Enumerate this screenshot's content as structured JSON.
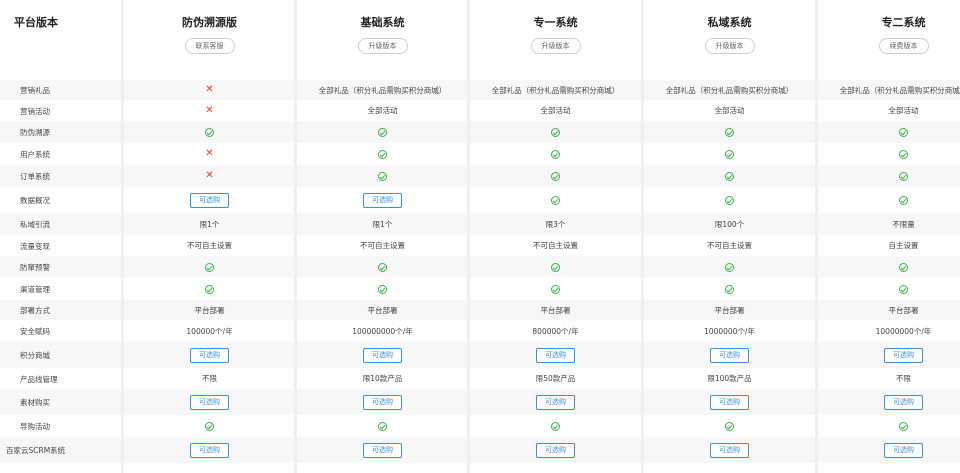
{
  "header_label": "平台版本",
  "plans": [
    {
      "name": "防伪溯源版",
      "button": "联系客服"
    },
    {
      "name": "基础系统",
      "button": "升级版本"
    },
    {
      "name": "专一系统",
      "button": "升级版本"
    },
    {
      "name": "私域系统",
      "button": "升级版本"
    },
    {
      "name": "专二系统",
      "button": "续费版本"
    }
  ],
  "cell_types": {
    "x": "cross-icon",
    "ok": "check-circle-icon",
    "opt": "optional-purchase-button"
  },
  "option_label": "可选购",
  "rows": [
    {
      "label": "营销礼品",
      "cells": [
        {
          "t": "x"
        },
        {
          "t": "text",
          "v": "全部礼品（积分礼品需购买积分商城）"
        },
        {
          "t": "text",
          "v": "全部礼品（积分礼品需购买积分商城）"
        },
        {
          "t": "text",
          "v": "全部礼品（积分礼品需购买积分商城）"
        },
        {
          "t": "text",
          "v": "全部礼品（积分礼品需购买积分商城）"
        }
      ]
    },
    {
      "label": "营销活动",
      "cells": [
        {
          "t": "x"
        },
        {
          "t": "text",
          "v": "全部活动"
        },
        {
          "t": "text",
          "v": "全部活动"
        },
        {
          "t": "text",
          "v": "全部活动"
        },
        {
          "t": "text",
          "v": "全部活动"
        }
      ]
    },
    {
      "label": "防伪溯源",
      "cells": [
        {
          "t": "ok"
        },
        {
          "t": "ok"
        },
        {
          "t": "ok"
        },
        {
          "t": "ok"
        },
        {
          "t": "ok"
        }
      ]
    },
    {
      "label": "用户系统",
      "cells": [
        {
          "t": "x"
        },
        {
          "t": "ok"
        },
        {
          "t": "ok"
        },
        {
          "t": "ok"
        },
        {
          "t": "ok"
        }
      ]
    },
    {
      "label": "订单系统",
      "cells": [
        {
          "t": "x"
        },
        {
          "t": "ok"
        },
        {
          "t": "ok"
        },
        {
          "t": "ok"
        },
        {
          "t": "ok"
        }
      ]
    },
    {
      "label": "数据概况",
      "cells": [
        {
          "t": "opt"
        },
        {
          "t": "opt"
        },
        {
          "t": "ok"
        },
        {
          "t": "ok"
        },
        {
          "t": "ok"
        }
      ]
    },
    {
      "label": "私域引流",
      "cells": [
        {
          "t": "text",
          "v": "限1个"
        },
        {
          "t": "text",
          "v": "限1个"
        },
        {
          "t": "text",
          "v": "限3个"
        },
        {
          "t": "text",
          "v": "限100个"
        },
        {
          "t": "text",
          "v": "不限量"
        }
      ]
    },
    {
      "label": "流量变现",
      "cells": [
        {
          "t": "text",
          "v": "不可自主设置"
        },
        {
          "t": "text",
          "v": "不可自主设置"
        },
        {
          "t": "text",
          "v": "不可自主设置"
        },
        {
          "t": "text",
          "v": "不可自主设置"
        },
        {
          "t": "text",
          "v": "自主设置"
        }
      ]
    },
    {
      "label": "防窜预警",
      "cells": [
        {
          "t": "ok"
        },
        {
          "t": "ok"
        },
        {
          "t": "ok"
        },
        {
          "t": "ok"
        },
        {
          "t": "ok"
        }
      ]
    },
    {
      "label": "渠道管理",
      "cells": [
        {
          "t": "ok"
        },
        {
          "t": "ok"
        },
        {
          "t": "ok"
        },
        {
          "t": "ok"
        },
        {
          "t": "ok"
        }
      ]
    },
    {
      "label": "部署方式",
      "cells": [
        {
          "t": "text",
          "v": "平台部署"
        },
        {
          "t": "text",
          "v": "平台部署"
        },
        {
          "t": "text",
          "v": "平台部署"
        },
        {
          "t": "text",
          "v": "平台部署"
        },
        {
          "t": "text",
          "v": "平台部署"
        }
      ]
    },
    {
      "label": "安全赋码",
      "cells": [
        {
          "t": "text",
          "v": "100000个/年"
        },
        {
          "t": "text",
          "v": "100000000个/年"
        },
        {
          "t": "text",
          "v": "800000个/年"
        },
        {
          "t": "text",
          "v": "1000000个/年"
        },
        {
          "t": "text",
          "v": "10000000个/年"
        }
      ]
    },
    {
      "label": "积分商城",
      "cells": [
        {
          "t": "opt"
        },
        {
          "t": "opt"
        },
        {
          "t": "opt"
        },
        {
          "t": "opt"
        },
        {
          "t": "opt"
        }
      ]
    },
    {
      "label": "产品线管理",
      "cells": [
        {
          "t": "text",
          "v": "不限"
        },
        {
          "t": "text",
          "v": "限10款产品"
        },
        {
          "t": "text",
          "v": "限50款产品"
        },
        {
          "t": "text",
          "v": "限100款产品"
        },
        {
          "t": "text",
          "v": "不限"
        }
      ]
    },
    {
      "label": "素材购买",
      "cells": [
        {
          "t": "opt"
        },
        {
          "t": "opt"
        },
        {
          "t": "opt"
        },
        {
          "t": "opt"
        },
        {
          "t": "opt"
        }
      ]
    },
    {
      "label": "导购活动",
      "cells": [
        {
          "t": "ok"
        },
        {
          "t": "ok"
        },
        {
          "t": "ok"
        },
        {
          "t": "ok"
        },
        {
          "t": "ok"
        }
      ]
    },
    {
      "label": "百家云SCRM系统",
      "cells": [
        {
          "t": "opt"
        },
        {
          "t": "opt"
        },
        {
          "t": "opt"
        },
        {
          "t": "opt"
        },
        {
          "t": "opt"
        }
      ]
    }
  ]
}
